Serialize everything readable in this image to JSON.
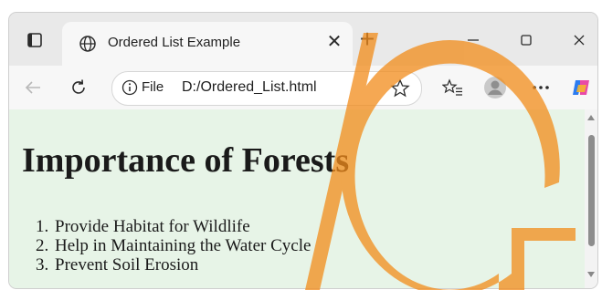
{
  "browser": {
    "tab": {
      "title": "Ordered List Example",
      "close_glyph": "✕"
    },
    "new_tab_glyph": "+",
    "window_controls": [
      "minimize-icon",
      "maximize-icon",
      "close-icon"
    ],
    "address_bar": {
      "scheme_label": "File",
      "url": "D:/Ordered_List.html"
    }
  },
  "page": {
    "heading": "Importance of Forests",
    "list_items": [
      "Provide Habitat for Wildlife",
      "Help in Maintaining the Water Cycle",
      "Prevent Soil Erosion"
    ]
  },
  "colors": {
    "page_background": "#e7f4e7",
    "watermark": "#f28c1a"
  }
}
